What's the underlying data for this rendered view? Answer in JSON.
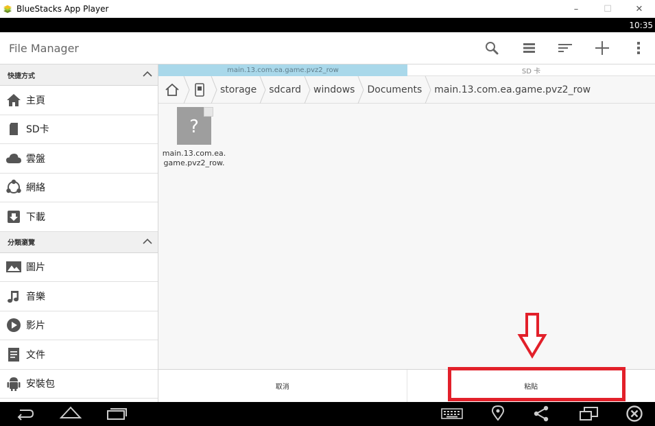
{
  "window": {
    "title": "BlueStacks App Player",
    "controls": [
      "–",
      "☐",
      "✕"
    ]
  },
  "status_bar": {
    "time": "10:35"
  },
  "action_bar": {
    "title": "File Manager",
    "icons": [
      "search-icon",
      "view-list-icon",
      "sort-icon",
      "add-icon",
      "overflow-menu-icon"
    ]
  },
  "sidebar": {
    "sections": [
      {
        "header": "快捷方式",
        "items": [
          {
            "label": "主頁",
            "icon": "home-icon"
          },
          {
            "label": "SD卡",
            "icon": "sd-card-icon"
          },
          {
            "label": "雲盤",
            "icon": "cloud-icon"
          },
          {
            "label": "網絡",
            "icon": "network-icon"
          },
          {
            "label": "下載",
            "icon": "download-icon"
          }
        ]
      },
      {
        "header": "分類瀏覽",
        "items": [
          {
            "label": "圖片",
            "icon": "image-icon"
          },
          {
            "label": "音樂",
            "icon": "music-icon"
          },
          {
            "label": "影片",
            "icon": "video-icon"
          },
          {
            "label": "文件",
            "icon": "document-icon"
          },
          {
            "label": "安裝包",
            "icon": "android-icon"
          }
        ]
      }
    ]
  },
  "tabs": [
    {
      "label": "main.13.com.ea.game.pvz2_row",
      "active": true
    },
    {
      "label": "SD 卡",
      "active": false
    }
  ],
  "breadcrumb": [
    "storage",
    "sdcard",
    "windows",
    "Documents",
    "main.13.com.ea.game.pvz2_row"
  ],
  "files": [
    {
      "name": "main.13.com.ea.game.pvz2_row.",
      "icon": "unknown-file-icon"
    }
  ],
  "bottom_bar": {
    "cancel_label": "取消",
    "paste_label": "粘貼"
  },
  "colors": {
    "active_tab": "#a9d8ea",
    "highlight": "#e2202a"
  }
}
